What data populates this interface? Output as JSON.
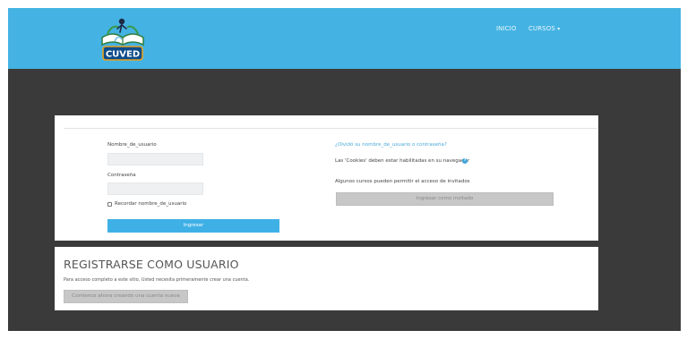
{
  "brand": {
    "logo_text": "CUVED"
  },
  "nav": {
    "inicio": "INICIO",
    "cursos": "CURSOS"
  },
  "login": {
    "username_label": "Nombre_de_usuario",
    "password_label": "Contraseña",
    "username_value": "",
    "password_value": "",
    "remember_label": "Recordar nombre_de_usuario",
    "submit_label": "Ingresar",
    "forgot_link": "¿Olvidó su nombre_de_usuario o contraseña?",
    "cookies_text": "Las 'Cookies' deben estar habilitadas en su navegador",
    "guest_info": "Algunos cursos pueden permitir el acceso de invitados",
    "guest_button": "Ingresar como invitado"
  },
  "register": {
    "title": "REGISTRARSE COMO USUARIO",
    "text": "Para acceso completo a este sitio, Usted necesita primeramente crear una cuenta.",
    "button": "Comience ahora creando una cuenta nueva"
  },
  "colors": {
    "topbar": "#44b3e3",
    "dark_bg": "#3a3a3a",
    "primary": "#3fb0e6",
    "link": "#4aa9d8"
  }
}
